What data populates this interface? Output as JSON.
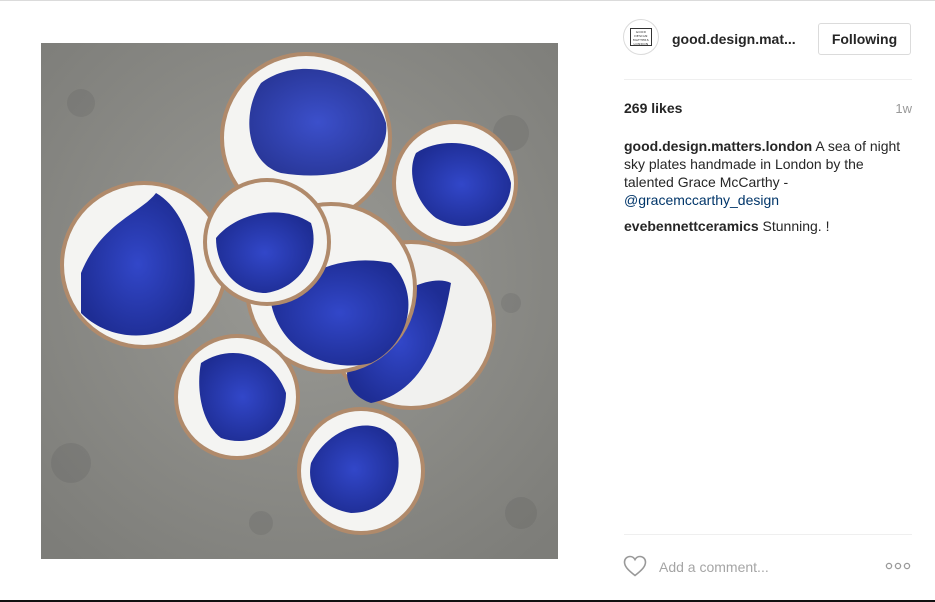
{
  "post": {
    "image_alt": "Handmade blue and white ceramic plates on concrete",
    "avatar_text": "GOOD DESIGN MATTERS LONDON",
    "username": "good.design.mat...",
    "follow_label": "Following",
    "likes": "269 likes",
    "time": "1w",
    "caption": {
      "user": "good.design.matters.london",
      "text": "A sea of night sky plates handmade in London by the talented Grace McCarthy -",
      "mention": "@gracemccarthy_design"
    },
    "comments": [
      {
        "user": "evebennettceramics",
        "text": "Stunning. !"
      }
    ],
    "add_comment_placeholder": "Add a comment..."
  },
  "icons": {
    "like": "heart-icon",
    "more": "more-options-icon"
  },
  "colors": {
    "link": "#003569",
    "plate_blue": "#2a3fb0",
    "border": "#dbdbdb"
  }
}
